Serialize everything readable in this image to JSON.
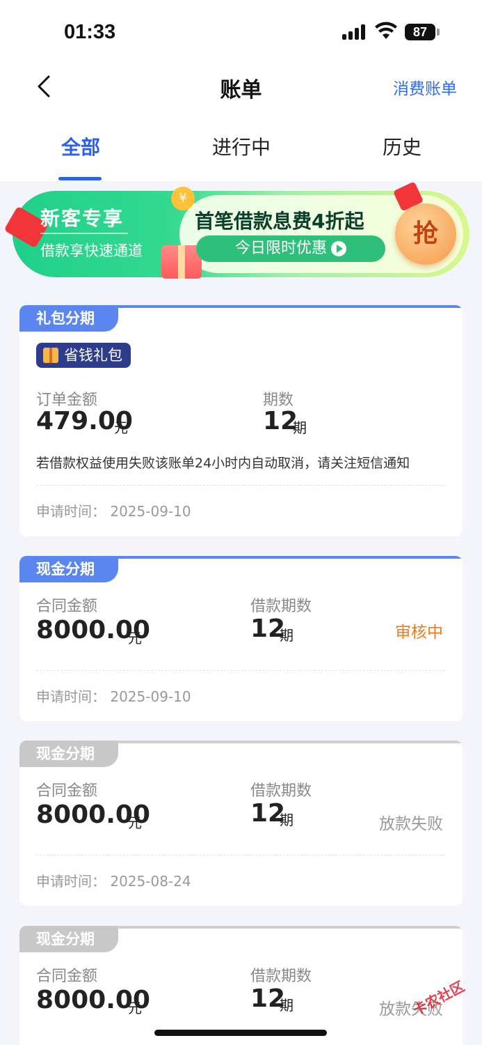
{
  "status_bar": {
    "time": "01:33",
    "battery": "87"
  },
  "nav": {
    "title": "账单",
    "right_link": "消费账单"
  },
  "tabs": [
    {
      "label": "全部"
    },
    {
      "label": "进行中"
    },
    {
      "label": "历史"
    }
  ],
  "banner": {
    "left_title": "新客专享",
    "left_sub": "借款享快速通道",
    "headline": "首笔借款息费4折起",
    "button": "今日限时优惠",
    "grab": "抢",
    "coin": "¥"
  },
  "cards": [
    {
      "tag": "礼包分期",
      "badge": "省钱礼包",
      "amount_label": "订单金额",
      "amount": "479.00",
      "unit": "元",
      "periods_label": "期数",
      "periods": "12",
      "periods_unit": "期",
      "notice": "若借款权益使用失败该账单24小时内自动取消，请关注短信通知",
      "time": "申请时间：  2025-09-10"
    },
    {
      "tag": "现金分期",
      "amount_label": "合同金额",
      "amount": "8000.00",
      "unit": "元",
      "periods_label": "借款期数",
      "periods": "12",
      "periods_unit": "期",
      "status": "审核中",
      "time": "申请时间：  2025-09-10"
    },
    {
      "tag": "现金分期",
      "amount_label": "合同金额",
      "amount": "8000.00",
      "unit": "元",
      "periods_label": "借款期数",
      "periods": "12",
      "periods_unit": "期",
      "status": "放款失败",
      "time": "申请时间：  2025-08-24"
    },
    {
      "tag": "现金分期",
      "amount_label": "合同金额",
      "amount": "8000.00",
      "unit": "元",
      "periods_label": "借款期数",
      "periods": "12",
      "periods_unit": "期",
      "status": "放款失败"
    }
  ],
  "watermark": "卡农社区",
  "colors": {
    "accent": "#2a62ee",
    "review": "#f07a1e",
    "muted": "#999999",
    "tag_active": "#5b86f0",
    "tag_inactive": "#c8c8c8"
  }
}
